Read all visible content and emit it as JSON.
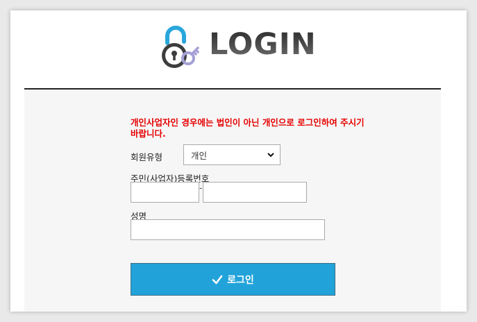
{
  "logo": {
    "text": "LOGIN"
  },
  "notice": "개인사업자인 경우에는 법인이 아닌 개인으로 로그인하여 주시기 바랍니다.",
  "form": {
    "member_type_label": "회원유형",
    "member_type_value": "개인",
    "reg_number_label": "주민(사업자)등록번호",
    "reg_number_sep": "-",
    "name_label": "성명",
    "login_button": "로그인"
  },
  "colors": {
    "notice": "#e60000",
    "button": "#21a3d9",
    "panel": "#f6f6f6",
    "divider": "#222222"
  },
  "icons": [
    "padlock-icon",
    "key-icon",
    "check-icon",
    "chevron-down-icon"
  ]
}
